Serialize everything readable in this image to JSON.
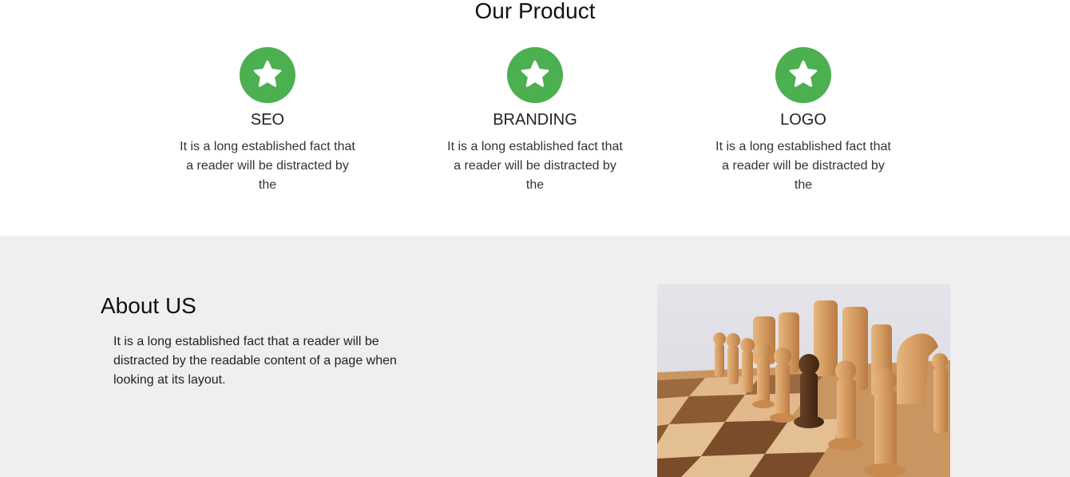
{
  "product": {
    "title": "Our Product",
    "accent_color": "#4caf50",
    "cards": [
      {
        "icon": "star-icon",
        "title": "SEO",
        "text": "It is a long established fact that a reader will be distracted by the"
      },
      {
        "icon": "star-icon",
        "title": "BRANDING",
        "text": "It is a long established fact that a reader will be distracted by the"
      },
      {
        "icon": "star-icon",
        "title": "LOGO",
        "text": "It is a long established fact that a reader will be distracted by the"
      }
    ]
  },
  "about": {
    "title": "About US",
    "text": "It is a long established fact that a reader will be distracted by the readable content of a page when looking at its layout.",
    "background_color": "#efefef",
    "image": "chess-board-image"
  }
}
